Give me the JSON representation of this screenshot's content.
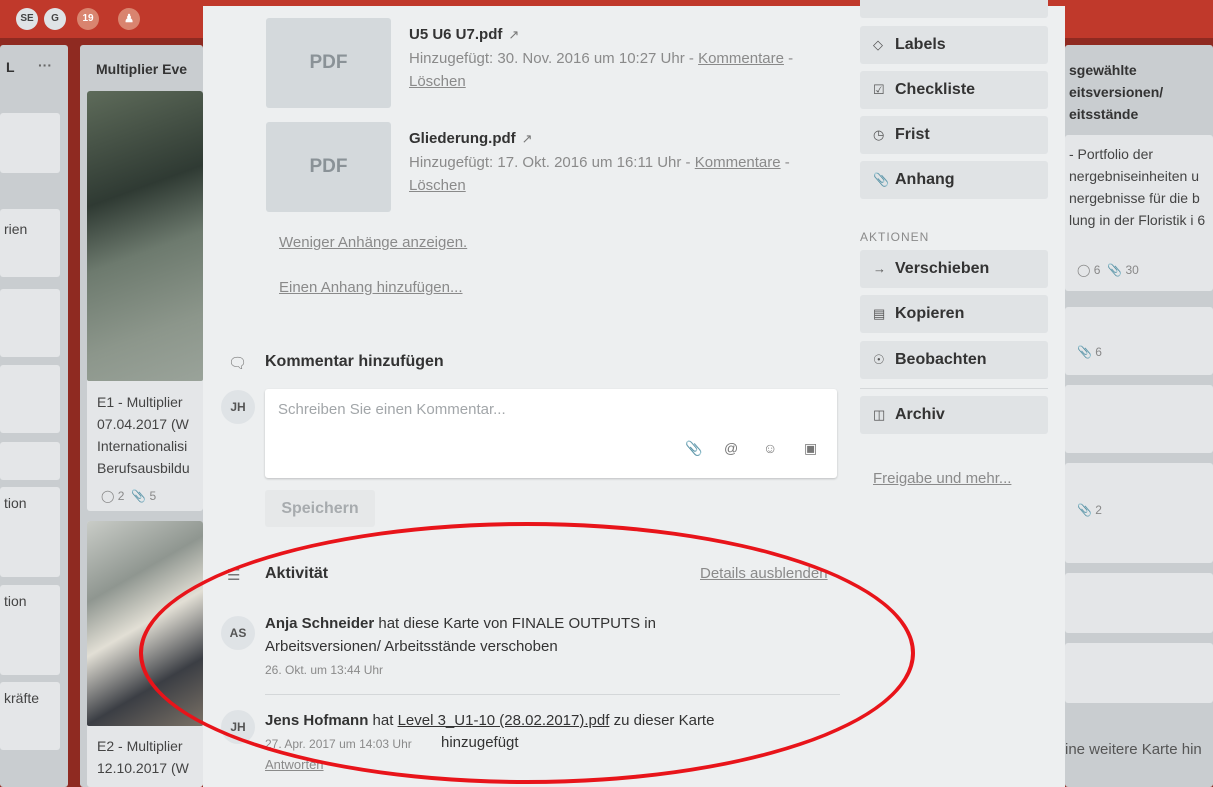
{
  "header": {
    "avatars": [
      "SE",
      "G"
    ],
    "member_count": "19",
    "add_member_icon": "person-add-icon"
  },
  "board": {
    "left_list": {
      "title": "L",
      "menu": "···",
      "card_labels": [
        "rien",
        "tion",
        "tion",
        "kräfte"
      ]
    },
    "middle_list": {
      "title": "Multiplier Eve",
      "card1": {
        "text": "E1 - Multiplier 07.04.2017 (W Internationalisi Berufsausbildu",
        "badges": {
          "comments": "2",
          "attachments": "5"
        }
      },
      "card2": {
        "text": "E2 - Multiplier 12.10.2017 (W"
      }
    },
    "right_list": {
      "title": "sgewählte eitsversionen/ eitsstände",
      "card1": {
        "text": "- Portfolio der nergebniseinheiten u nergebnisse für die b lung in der Floristik i 6",
        "badges": {
          "comments": "6",
          "attachments": "30"
        }
      },
      "badge_6": "6",
      "badge_2": "2",
      "add_card": "ine weitere Karte hin"
    }
  },
  "attachments": [
    {
      "thumb": "PDF",
      "name": "U5 U6 U7.pdf",
      "added": "Hinzugefügt: 30. Nov. 2016 um 10:27 Uhr",
      "comments_link": "Kommentare",
      "delete_link": "Löschen"
    },
    {
      "thumb": "PDF",
      "name": "Gliederung.pdf",
      "added": "Hinzugefügt: 17. Okt. 2016 um 16:11 Uhr",
      "comments_link": "Kommentare",
      "delete_link": "Löschen"
    }
  ],
  "links": {
    "fewer_attachments": "Weniger Anhänge anzeigen.",
    "add_attachment": "Einen Anhang hinzufügen..."
  },
  "comment": {
    "title": "Kommentar hinzufügen",
    "avatar": "JH",
    "placeholder": "Schreiben Sie einen Kommentar...",
    "save": "Speichern"
  },
  "activity": {
    "title": "Aktivität",
    "toggle": "Details ausblenden",
    "items": [
      {
        "avatar": "AS",
        "user": "Anja Schneider",
        "text": "hat diese Karte von FINALE OUTPUTS in Arbeitsversionen/ Arbeitsstände verschoben",
        "time": "26. Okt. um 13:44 Uhr"
      },
      {
        "avatar": "JH",
        "user": "Jens Hofmann",
        "pre": "hat",
        "file": "Level 3_U1-10 (28.02.2017).pdf",
        "post": "zu dieser Karte",
        "time": "27. Apr. 2017 um 14:03 Uhr",
        "post2": "hinzugefügt",
        "reply": "Antworten"
      }
    ]
  },
  "sidebar": {
    "add_buttons": [
      {
        "icon": "tag-icon",
        "label": "Labels"
      },
      {
        "icon": "checklist-icon",
        "label": "Checkliste"
      },
      {
        "icon": "clock-icon",
        "label": "Frist"
      },
      {
        "icon": "paperclip-icon",
        "label": "Anhang"
      }
    ],
    "actions_heading": "AKTIONEN",
    "action_buttons": [
      {
        "icon": "arrow-right-icon",
        "label": "Verschieben"
      },
      {
        "icon": "copy-icon",
        "label": "Kopieren"
      },
      {
        "icon": "eye-icon",
        "label": "Beobachten"
      }
    ],
    "archive": {
      "icon": "archive-icon",
      "label": "Archiv"
    },
    "share_link": "Freigabe und mehr..."
  }
}
